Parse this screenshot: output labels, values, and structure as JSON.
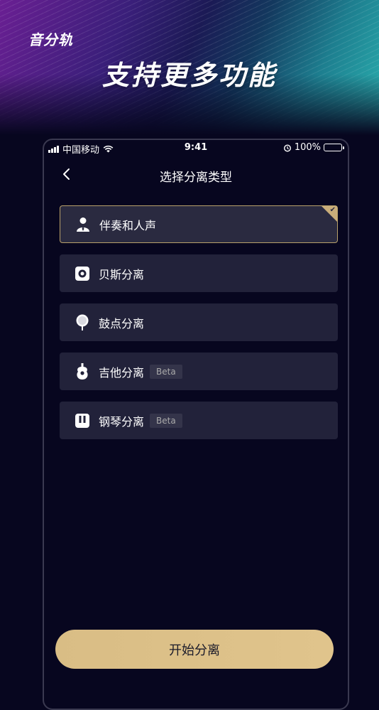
{
  "hero": {
    "brand": "音分轨",
    "headline": "支持更多功能"
  },
  "status_bar": {
    "carrier": "中国移动",
    "time": "9:41",
    "battery": "100%"
  },
  "nav": {
    "title": "选择分离类型"
  },
  "options": [
    {
      "label": "伴奏和人声",
      "icon": "person-icon",
      "selected": true,
      "badge": ""
    },
    {
      "label": "贝斯分离",
      "icon": "speaker-icon",
      "selected": false,
      "badge": ""
    },
    {
      "label": "鼓点分离",
      "icon": "drumstick-icon",
      "selected": false,
      "badge": ""
    },
    {
      "label": "吉他分离",
      "icon": "guitar-icon",
      "selected": false,
      "badge": "Beta"
    },
    {
      "label": "钢琴分离",
      "icon": "piano-icon",
      "selected": false,
      "badge": "Beta"
    }
  ],
  "actions": {
    "start_label": "开始分离"
  },
  "colors": {
    "background": "#07061f",
    "option_bg": "#22223a",
    "accent_gold": "#dcc087",
    "selected_border": "#b8a06a"
  }
}
